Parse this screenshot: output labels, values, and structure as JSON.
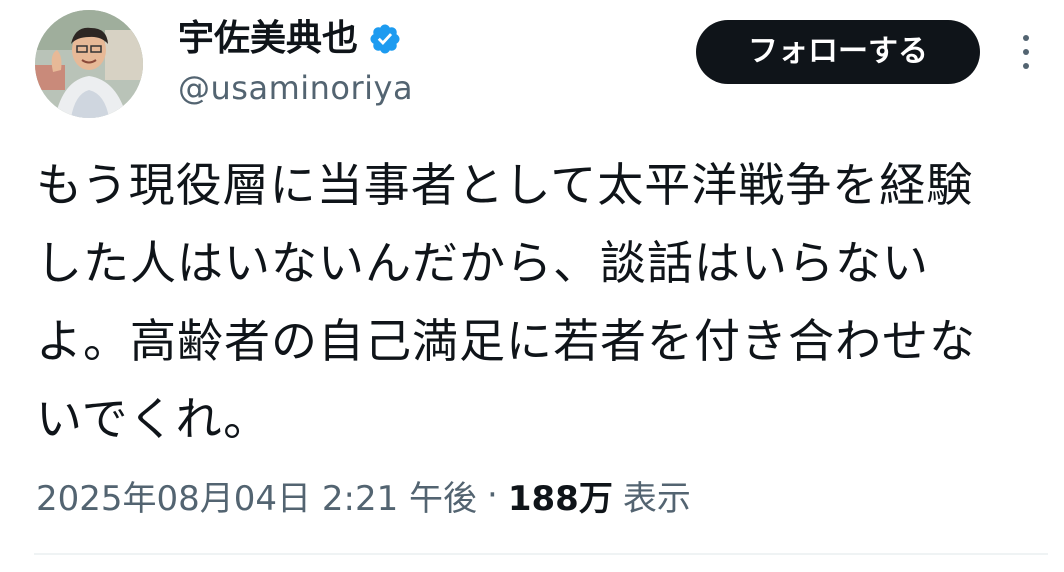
{
  "author": {
    "display_name": "宇佐美典也",
    "handle": "@usaminoriya",
    "verified": true
  },
  "actions": {
    "follow_label": "フォローする"
  },
  "tweet": {
    "text": "もう現役層に当事者として太平洋戦争を経験\nした人はいないんだから、談話はいらない\nよ。高齢者の自己満足に若者を付き合わせな\nいでくれ。"
  },
  "meta": {
    "timestamp": "2025年08月04日 2:21 午後",
    "separator": "·",
    "views_count": "188万",
    "views_label": "表示"
  },
  "colors": {
    "text_primary": "#0f1419",
    "text_secondary": "#536471",
    "verified_blue": "#1d9bf0",
    "follow_bg": "#0f1419",
    "divider": "#eff3f4"
  },
  "icons": {
    "verified": "verified-badge-icon",
    "more": "more-vertical-icon"
  }
}
